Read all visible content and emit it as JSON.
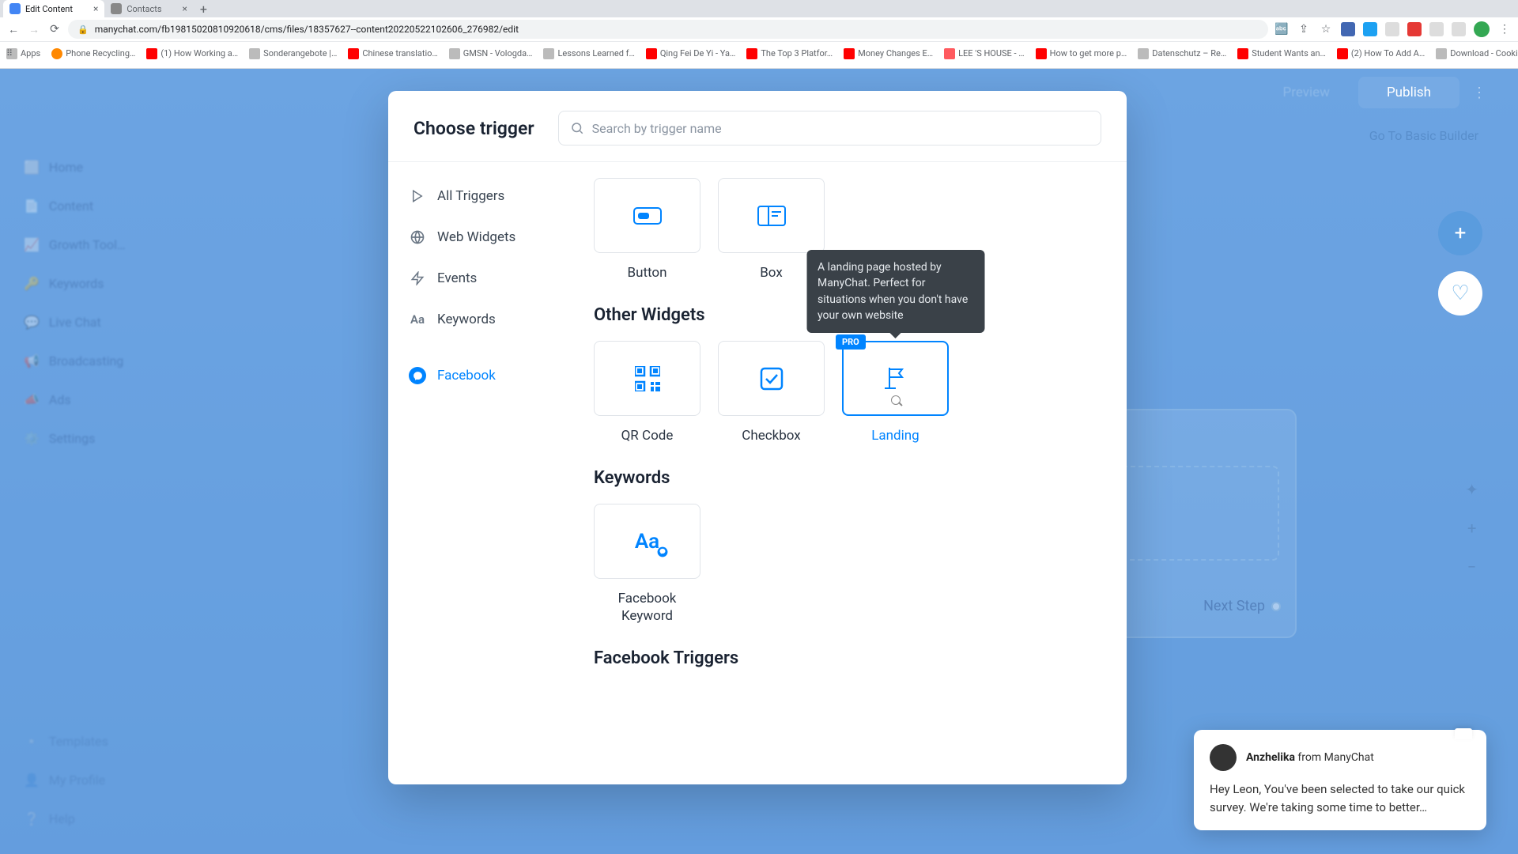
{
  "browser": {
    "tabs": [
      {
        "title": "Edit Content",
        "active": true
      },
      {
        "title": "Contacts",
        "active": false
      }
    ],
    "url": "manychat.com/fb19815020810920618/cms/files/18357627--content20220522102606_276982/edit",
    "bookmarks": [
      "Apps",
      "Phone Recycling…",
      "(1) How Working a…",
      "Sonderangebote |…",
      "Chinese translatio…",
      "GMSN - Vologda…",
      "Lessons Learned f…",
      "Qing Fei De Yi - Ya…",
      "The Top 3 Platfor…",
      "Money Changes E…",
      "LEE 'S HOUSE - …",
      "How to get more p…",
      "Datenschutz – Re…",
      "Student Wants an…",
      "(2) How To Add A…",
      "Download - Cooki…"
    ]
  },
  "toolbar": {
    "preview": "Preview",
    "publish": "Publish",
    "goto_basic": "Go To Basic Builder"
  },
  "bg_nav": [
    "…",
    "Home",
    "Content",
    "Growth Tool…",
    "Keywords",
    "Live Chat",
    "Broadcasting",
    "Ads",
    "Settings",
    "Templates",
    "My Profile",
    "Help"
  ],
  "node": {
    "next_step": "Next Step"
  },
  "modal": {
    "title": "Choose trigger",
    "search_placeholder": "Search by trigger name",
    "categories": [
      {
        "key": "all",
        "label": "All Triggers"
      },
      {
        "key": "web",
        "label": "Web Widgets"
      },
      {
        "key": "events",
        "label": "Events"
      },
      {
        "key": "keywords",
        "label": "Keywords"
      },
      {
        "key": "facebook",
        "label": "Facebook",
        "active": true
      }
    ],
    "sections": {
      "row1": [
        {
          "key": "button",
          "label": "Button"
        },
        {
          "key": "box",
          "label": "Box"
        }
      ],
      "other_widgets_title": "Other Widgets",
      "other_widgets": [
        {
          "key": "qrcode",
          "label": "QR Code"
        },
        {
          "key": "checkbox",
          "label": "Checkbox"
        },
        {
          "key": "landing",
          "label": "Landing",
          "pro": true,
          "selected": true
        }
      ],
      "keywords_title": "Keywords",
      "keywords": [
        {
          "key": "fb-keyword",
          "label": "Facebook\nKeyword"
        }
      ],
      "fb_triggers_title": "Facebook Triggers"
    },
    "pro_badge": "PRO",
    "tooltip": "A landing page hosted by ManyChat. Perfect for situations when you don't have your own website"
  },
  "chat": {
    "sender_name": "Anzhelika",
    "sender_from": " from ManyChat",
    "message": "Hey Leon,  You've been selected to take our quick survey. We're taking some time to better…"
  }
}
